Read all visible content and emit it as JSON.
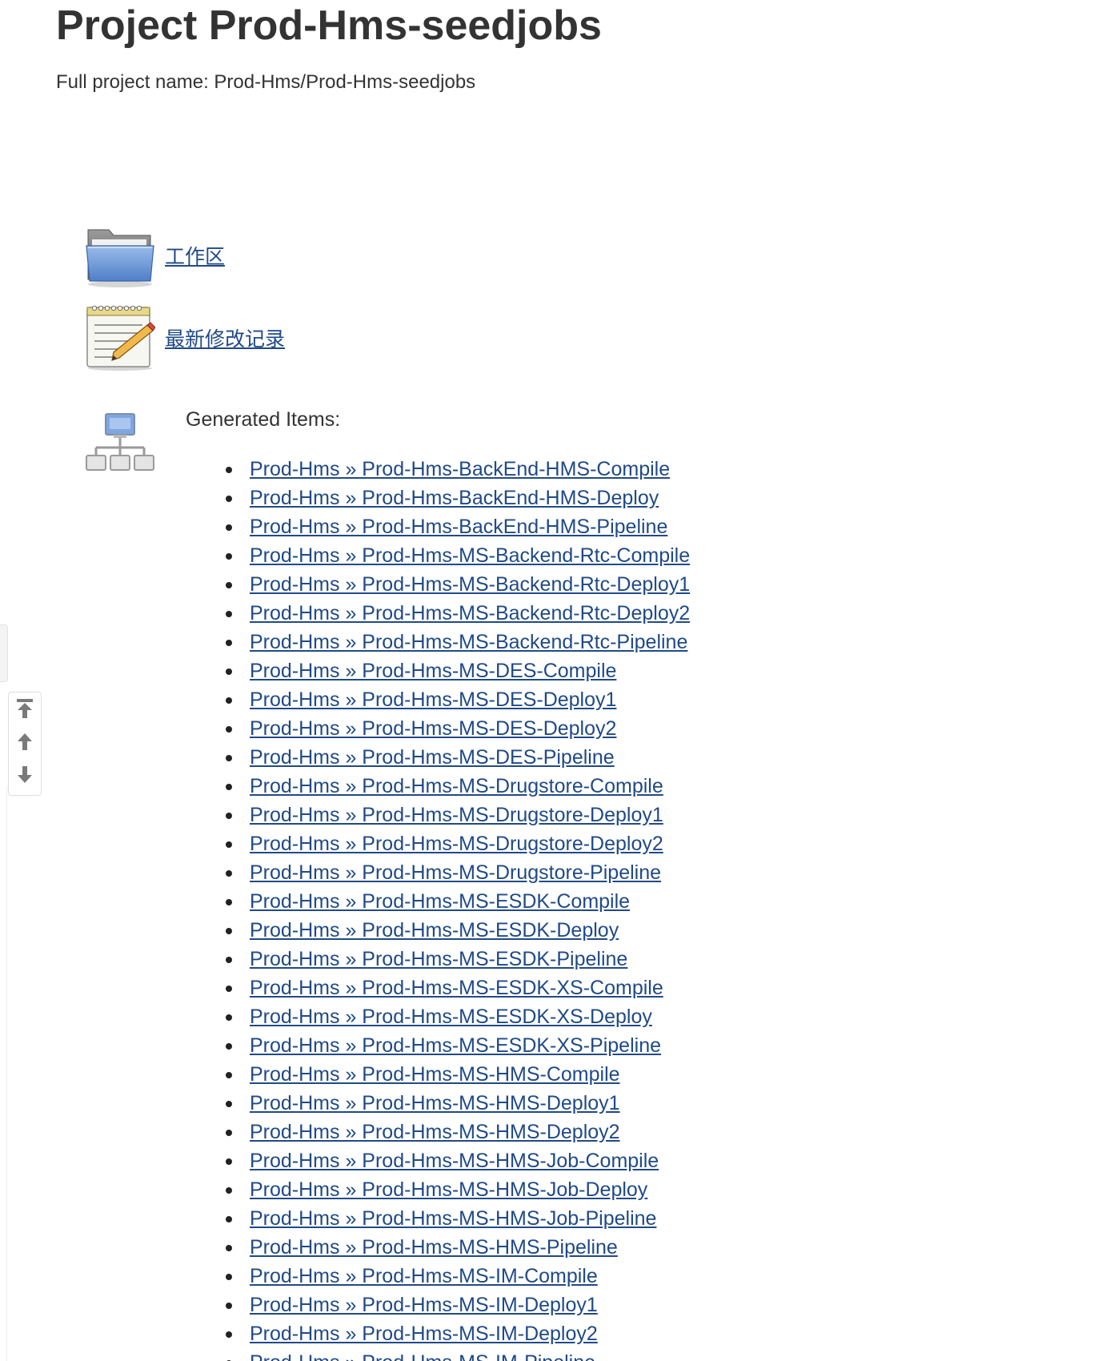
{
  "header": {
    "title": "Project Prod-Hms-seedjobs",
    "full_name": "Full project name: Prod-Hms/Prod-Hms-seedjobs"
  },
  "tasks": [
    {
      "label": "工作区",
      "icon": "folder-icon"
    },
    {
      "label": "最新修改记录",
      "icon": "notepad-icon"
    }
  ],
  "generated": {
    "label": "Generated Items:",
    "icon": "network-icon",
    "items": [
      "Prod-Hms » Prod-Hms-BackEnd-HMS-Compile",
      "Prod-Hms » Prod-Hms-BackEnd-HMS-Deploy",
      "Prod-Hms » Prod-Hms-BackEnd-HMS-Pipeline",
      "Prod-Hms » Prod-Hms-MS-Backend-Rtc-Compile",
      "Prod-Hms » Prod-Hms-MS-Backend-Rtc-Deploy1",
      "Prod-Hms » Prod-Hms-MS-Backend-Rtc-Deploy2",
      "Prod-Hms » Prod-Hms-MS-Backend-Rtc-Pipeline",
      "Prod-Hms » Prod-Hms-MS-DES-Compile",
      "Prod-Hms » Prod-Hms-MS-DES-Deploy1",
      "Prod-Hms » Prod-Hms-MS-DES-Deploy2",
      "Prod-Hms » Prod-Hms-MS-DES-Pipeline",
      "Prod-Hms » Prod-Hms-MS-Drugstore-Compile",
      "Prod-Hms » Prod-Hms-MS-Drugstore-Deploy1",
      "Prod-Hms » Prod-Hms-MS-Drugstore-Deploy2",
      "Prod-Hms » Prod-Hms-MS-Drugstore-Pipeline",
      "Prod-Hms » Prod-Hms-MS-ESDK-Compile",
      "Prod-Hms » Prod-Hms-MS-ESDK-Deploy",
      "Prod-Hms » Prod-Hms-MS-ESDK-Pipeline",
      "Prod-Hms » Prod-Hms-MS-ESDK-XS-Compile",
      "Prod-Hms » Prod-Hms-MS-ESDK-XS-Deploy",
      "Prod-Hms » Prod-Hms-MS-ESDK-XS-Pipeline",
      "Prod-Hms » Prod-Hms-MS-HMS-Compile",
      "Prod-Hms » Prod-Hms-MS-HMS-Deploy1",
      "Prod-Hms » Prod-Hms-MS-HMS-Deploy2",
      "Prod-Hms » Prod-Hms-MS-HMS-Job-Compile",
      "Prod-Hms » Prod-Hms-MS-HMS-Job-Deploy",
      "Prod-Hms » Prod-Hms-MS-HMS-Job-Pipeline",
      "Prod-Hms » Prod-Hms-MS-HMS-Pipeline",
      "Prod-Hms » Prod-Hms-MS-IM-Compile",
      "Prod-Hms » Prod-Hms-MS-IM-Deploy1",
      "Prod-Hms » Prod-Hms-MS-IM-Deploy2",
      "Prod-Hms » Prod-Hms-MS-IM-Pipeline"
    ]
  },
  "scroll_widget": {
    "buttons": [
      "scroll-to-top-icon",
      "scroll-up-icon",
      "scroll-down-icon"
    ]
  },
  "colors": {
    "link": "#204A87",
    "text": "#333333"
  }
}
